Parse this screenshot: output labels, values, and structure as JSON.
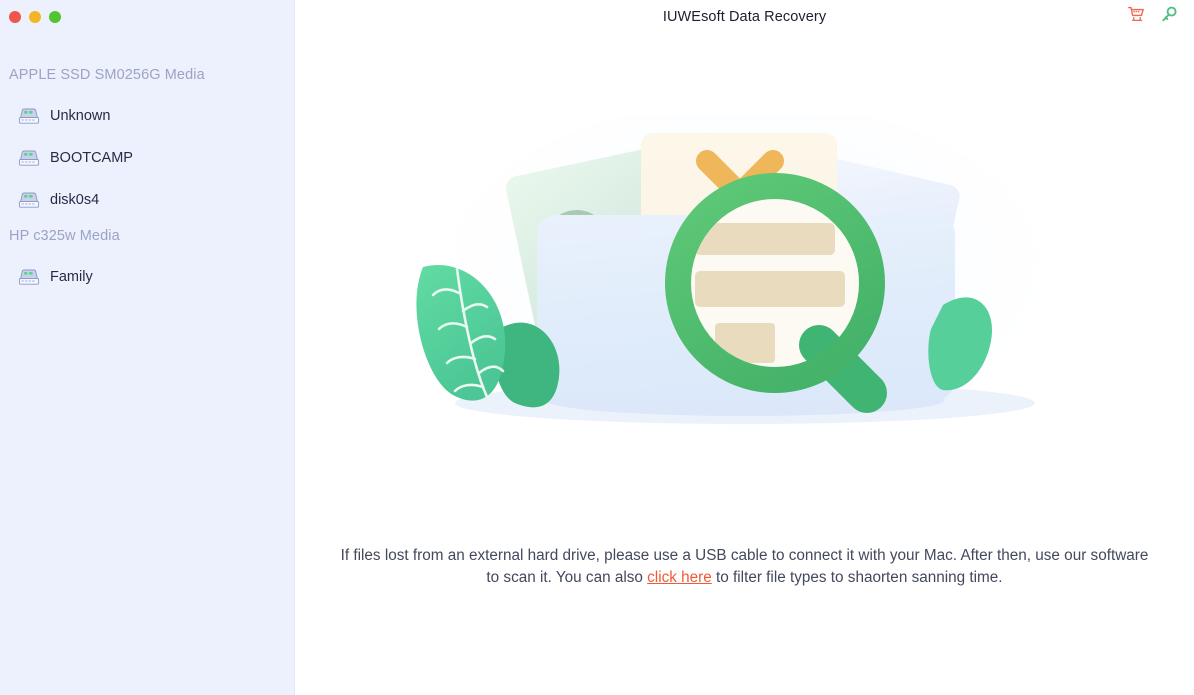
{
  "window": {
    "traffic_lights": [
      {
        "name": "close",
        "color": "#f0564a"
      },
      {
        "name": "minimize",
        "color": "#f5b426"
      },
      {
        "name": "maximize",
        "color": "#4fc530"
      }
    ]
  },
  "header": {
    "title": "IUWEsoft Data Recovery",
    "actions": [
      {
        "name": "cart-icon",
        "label": "Buy",
        "color": "#f4674f"
      },
      {
        "name": "key-icon",
        "label": "Register",
        "color": "#4fbf82"
      }
    ]
  },
  "sidebar": {
    "groups": [
      {
        "label": "APPLE SSD SM0256G Media",
        "items": [
          {
            "label": "Unknown",
            "icon": "drive-icon"
          },
          {
            "label": "BOOTCAMP",
            "icon": "drive-icon"
          },
          {
            "label": "disk0s4",
            "icon": "drive-icon"
          }
        ]
      },
      {
        "label": "HP c325w Media",
        "items": [
          {
            "label": "Family",
            "icon": "drive-icon"
          }
        ]
      }
    ]
  },
  "main": {
    "illustration": {
      "name": "folder-search-illustration",
      "elements": [
        "folder",
        "document-x",
        "document-circle",
        "document-lines",
        "magnifier",
        "leaf-left",
        "leaf-right",
        "shadow-ellipse"
      ],
      "colors": {
        "folder": "#e4eefb",
        "magnifier": "#4fbf6f",
        "cross": "#efb65a",
        "leaf": "#5ed49f",
        "shadow": "#dbe6fa"
      }
    },
    "caption": {
      "part1": "If files lost from an external hard drive, please use a USB cable to connect it with your Mac. After then, use our software to scan it. You can also ",
      "link": "click here",
      "part2": " to filter file types to shaorten sanning time."
    }
  }
}
